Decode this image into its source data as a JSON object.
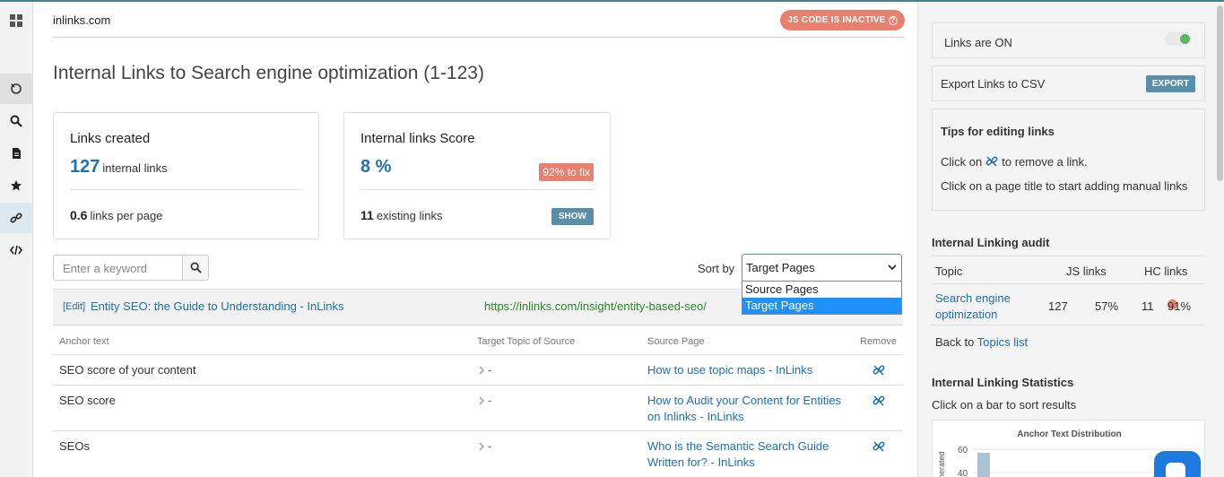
{
  "site": "inlinks.com",
  "js_badge": "JS CODE IS INACTIVE",
  "page_title": "Internal Links to Search engine optimization (1-123)",
  "links_created": {
    "title": "Links created",
    "count": "127",
    "count_label": "internal links",
    "per_page": "0.6",
    "per_page_label": "links per page"
  },
  "score": {
    "title": "Internal links Score",
    "value": "8 %",
    "fix_badge": "92% to fix",
    "existing": "11",
    "existing_label": "existing links",
    "show_label": "SHOW"
  },
  "search": {
    "placeholder": "Enter a keyword"
  },
  "sort": {
    "label": "Sort by",
    "selected": "Target Pages",
    "options": [
      "Source Pages",
      "Target Pages"
    ]
  },
  "group": {
    "edit_label": "[Edit]",
    "title": "Entity SEO: the Guide to Understanding - InLinks",
    "url": "https://inlinks.com/insight/entity-based-seo/"
  },
  "table": {
    "headers": [
      "Anchor text",
      "Target Topic of Source",
      "Source Page",
      "Remove"
    ],
    "rows": [
      {
        "anchor": "SEO score of your content",
        "topic": "-",
        "source": "How to use topic maps - InLinks"
      },
      {
        "anchor": "SEO score",
        "topic": "-",
        "source": "How to Audit your Content for Entities on Inlinks - InLinks"
      },
      {
        "anchor": "SEOs",
        "topic": "-",
        "source": "Who is the Semantic Search Guide Written for? - InLinks"
      }
    ]
  },
  "right": {
    "links_on": "Links are ON",
    "export_label": "Export Links to CSV",
    "export_btn": "EXPORT",
    "tips_title": "Tips for editing links",
    "tip1_pre": "Click on",
    "tip1_post": "to remove a link.",
    "tip2": "Click on a page title to start adding manual links",
    "audit_title": "Internal Linking audit",
    "audit_headers": [
      "Topic",
      "JS links",
      "HC links"
    ],
    "audit_row": {
      "topic": "Search engine optimization",
      "js_count": "127",
      "js_pct": "57%",
      "hc_count": "11",
      "hc_pct": "91%"
    },
    "back_pre": "Back to",
    "back_link": "Topics list",
    "stats_title": "Internal Linking Statistics",
    "stats_sub": "Click on a bar to sort results",
    "chart_title": "Anchor Text Distribution"
  },
  "colors": {
    "accent": "#1f6fb2",
    "badge": "#e8806f",
    "button": "#5b8ea8",
    "url_green": "#2a8a2a"
  }
}
